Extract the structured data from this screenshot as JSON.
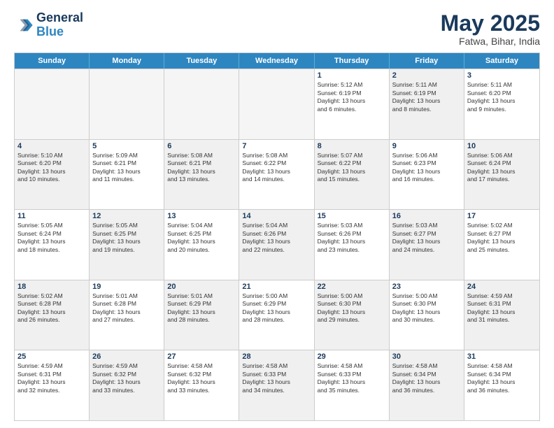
{
  "logo": {
    "line1": "General",
    "line2": "Blue"
  },
  "title": "May 2025",
  "subtitle": "Fatwa, Bihar, India",
  "header_days": [
    "Sunday",
    "Monday",
    "Tuesday",
    "Wednesday",
    "Thursday",
    "Friday",
    "Saturday"
  ],
  "weeks": [
    [
      {
        "day": "",
        "info": "",
        "shaded": true
      },
      {
        "day": "",
        "info": "",
        "shaded": true
      },
      {
        "day": "",
        "info": "",
        "shaded": true
      },
      {
        "day": "",
        "info": "",
        "shaded": true
      },
      {
        "day": "1",
        "info": "Sunrise: 5:12 AM\nSunset: 6:19 PM\nDaylight: 13 hours\nand 6 minutes.",
        "shaded": false
      },
      {
        "day": "2",
        "info": "Sunrise: 5:11 AM\nSunset: 6:19 PM\nDaylight: 13 hours\nand 8 minutes.",
        "shaded": true
      },
      {
        "day": "3",
        "info": "Sunrise: 5:11 AM\nSunset: 6:20 PM\nDaylight: 13 hours\nand 9 minutes.",
        "shaded": false
      }
    ],
    [
      {
        "day": "4",
        "info": "Sunrise: 5:10 AM\nSunset: 6:20 PM\nDaylight: 13 hours\nand 10 minutes.",
        "shaded": true
      },
      {
        "day": "5",
        "info": "Sunrise: 5:09 AM\nSunset: 6:21 PM\nDaylight: 13 hours\nand 11 minutes.",
        "shaded": false
      },
      {
        "day": "6",
        "info": "Sunrise: 5:08 AM\nSunset: 6:21 PM\nDaylight: 13 hours\nand 13 minutes.",
        "shaded": true
      },
      {
        "day": "7",
        "info": "Sunrise: 5:08 AM\nSunset: 6:22 PM\nDaylight: 13 hours\nand 14 minutes.",
        "shaded": false
      },
      {
        "day": "8",
        "info": "Sunrise: 5:07 AM\nSunset: 6:22 PM\nDaylight: 13 hours\nand 15 minutes.",
        "shaded": true
      },
      {
        "day": "9",
        "info": "Sunrise: 5:06 AM\nSunset: 6:23 PM\nDaylight: 13 hours\nand 16 minutes.",
        "shaded": false
      },
      {
        "day": "10",
        "info": "Sunrise: 5:06 AM\nSunset: 6:24 PM\nDaylight: 13 hours\nand 17 minutes.",
        "shaded": true
      }
    ],
    [
      {
        "day": "11",
        "info": "Sunrise: 5:05 AM\nSunset: 6:24 PM\nDaylight: 13 hours\nand 18 minutes.",
        "shaded": false
      },
      {
        "day": "12",
        "info": "Sunrise: 5:05 AM\nSunset: 6:25 PM\nDaylight: 13 hours\nand 19 minutes.",
        "shaded": true
      },
      {
        "day": "13",
        "info": "Sunrise: 5:04 AM\nSunset: 6:25 PM\nDaylight: 13 hours\nand 20 minutes.",
        "shaded": false
      },
      {
        "day": "14",
        "info": "Sunrise: 5:04 AM\nSunset: 6:26 PM\nDaylight: 13 hours\nand 22 minutes.",
        "shaded": true
      },
      {
        "day": "15",
        "info": "Sunrise: 5:03 AM\nSunset: 6:26 PM\nDaylight: 13 hours\nand 23 minutes.",
        "shaded": false
      },
      {
        "day": "16",
        "info": "Sunrise: 5:03 AM\nSunset: 6:27 PM\nDaylight: 13 hours\nand 24 minutes.",
        "shaded": true
      },
      {
        "day": "17",
        "info": "Sunrise: 5:02 AM\nSunset: 6:27 PM\nDaylight: 13 hours\nand 25 minutes.",
        "shaded": false
      }
    ],
    [
      {
        "day": "18",
        "info": "Sunrise: 5:02 AM\nSunset: 6:28 PM\nDaylight: 13 hours\nand 26 minutes.",
        "shaded": true
      },
      {
        "day": "19",
        "info": "Sunrise: 5:01 AM\nSunset: 6:28 PM\nDaylight: 13 hours\nand 27 minutes.",
        "shaded": false
      },
      {
        "day": "20",
        "info": "Sunrise: 5:01 AM\nSunset: 6:29 PM\nDaylight: 13 hours\nand 28 minutes.",
        "shaded": true
      },
      {
        "day": "21",
        "info": "Sunrise: 5:00 AM\nSunset: 6:29 PM\nDaylight: 13 hours\nand 28 minutes.",
        "shaded": false
      },
      {
        "day": "22",
        "info": "Sunrise: 5:00 AM\nSunset: 6:30 PM\nDaylight: 13 hours\nand 29 minutes.",
        "shaded": true
      },
      {
        "day": "23",
        "info": "Sunrise: 5:00 AM\nSunset: 6:30 PM\nDaylight: 13 hours\nand 30 minutes.",
        "shaded": false
      },
      {
        "day": "24",
        "info": "Sunrise: 4:59 AM\nSunset: 6:31 PM\nDaylight: 13 hours\nand 31 minutes.",
        "shaded": true
      }
    ],
    [
      {
        "day": "25",
        "info": "Sunrise: 4:59 AM\nSunset: 6:31 PM\nDaylight: 13 hours\nand 32 minutes.",
        "shaded": false
      },
      {
        "day": "26",
        "info": "Sunrise: 4:59 AM\nSunset: 6:32 PM\nDaylight: 13 hours\nand 33 minutes.",
        "shaded": true
      },
      {
        "day": "27",
        "info": "Sunrise: 4:58 AM\nSunset: 6:32 PM\nDaylight: 13 hours\nand 33 minutes.",
        "shaded": false
      },
      {
        "day": "28",
        "info": "Sunrise: 4:58 AM\nSunset: 6:33 PM\nDaylight: 13 hours\nand 34 minutes.",
        "shaded": true
      },
      {
        "day": "29",
        "info": "Sunrise: 4:58 AM\nSunset: 6:33 PM\nDaylight: 13 hours\nand 35 minutes.",
        "shaded": false
      },
      {
        "day": "30",
        "info": "Sunrise: 4:58 AM\nSunset: 6:34 PM\nDaylight: 13 hours\nand 36 minutes.",
        "shaded": true
      },
      {
        "day": "31",
        "info": "Sunrise: 4:58 AM\nSunset: 6:34 PM\nDaylight: 13 hours\nand 36 minutes.",
        "shaded": false
      }
    ]
  ]
}
